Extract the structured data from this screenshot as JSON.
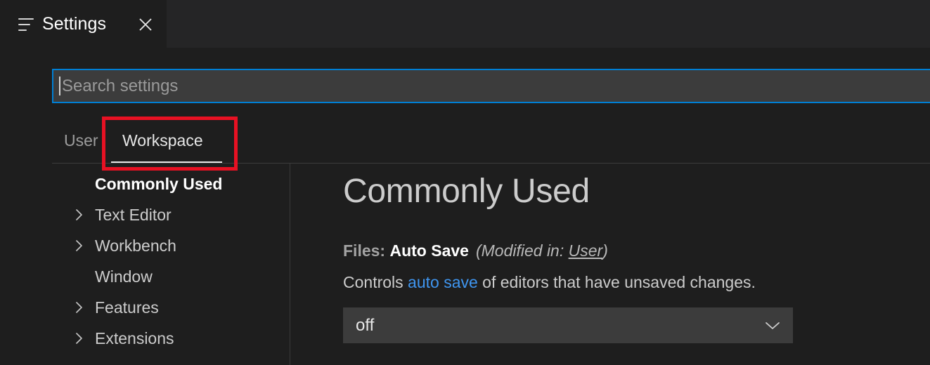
{
  "window": {
    "tab": {
      "icon": "settings-lines-icon",
      "title": "Settings",
      "close_icon": "close-icon"
    }
  },
  "search": {
    "placeholder": "Search settings",
    "value": "",
    "focus_color": "#007fd4"
  },
  "scope_tabs": {
    "items": [
      {
        "label": "User",
        "active": false
      },
      {
        "label": "Workspace",
        "active": true
      }
    ]
  },
  "annotation": {
    "color": "#e81123",
    "target": "Workspace"
  },
  "toc": {
    "items": [
      {
        "label": "Commonly Used",
        "expandable": false,
        "selected": true
      },
      {
        "label": "Text Editor",
        "expandable": true,
        "selected": false
      },
      {
        "label": "Workbench",
        "expandable": true,
        "selected": false
      },
      {
        "label": "Window",
        "expandable": false,
        "selected": false
      },
      {
        "label": "Features",
        "expandable": true,
        "selected": false
      },
      {
        "label": "Extensions",
        "expandable": true,
        "selected": false
      }
    ]
  },
  "detail": {
    "heading": "Commonly Used",
    "setting": {
      "category": "Files:",
      "name": "Auto Save",
      "modified_prefix": "(Modified in: ",
      "modified_scope": "User",
      "modified_suffix": ")",
      "desc_before": "Controls ",
      "desc_link": "auto save",
      "desc_after": " of editors that have unsaved changes.",
      "link_color": "#3f95ef",
      "value": "off",
      "dropdown_icon": "chevron-down-icon"
    }
  }
}
